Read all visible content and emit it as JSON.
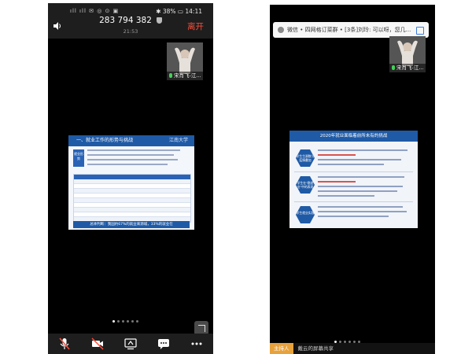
{
  "left": {
    "status_left": "ıll ıll ✉ ◎ ⊙ ▣",
    "status_right": "✱ 38% ▭ 14:11",
    "meeting_id": "283 794 382",
    "meeting_time": "21:53",
    "leave_label": "离开",
    "participant_name": "宋肖飞-江...",
    "slide": {
      "title": "一、就业工作的形势与挑战",
      "logo_text": "江南大学",
      "tab_text": "就业形势",
      "footer_text": "总体判断：我国约67%的就业来源城，33%的就业在"
    },
    "page_count": 6,
    "active_page": 1
  },
  "right": {
    "notification_text": "微信 • 四网格订菜群 • [3条]刘玲: 可以呀，您几...",
    "participant_name": "宋肖飞-江...",
    "slide": {
      "title": "2020年就业面临着前所未有的挑战",
      "hex1": "学生生源数与疫情叠加",
      "hex2": "学生在\"稳就业\"中的表现",
      "hex3": "学生就业实践"
    },
    "page_count": 6,
    "active_page": 1,
    "host_tag": "主持人",
    "host_text": "戴云的屏幕共享"
  },
  "colors": {
    "leave_red": "#ff4d3a",
    "slide_blue": "#1f5aa6",
    "mic_green": "#45d15a",
    "host_orange": "#e8a23b"
  }
}
